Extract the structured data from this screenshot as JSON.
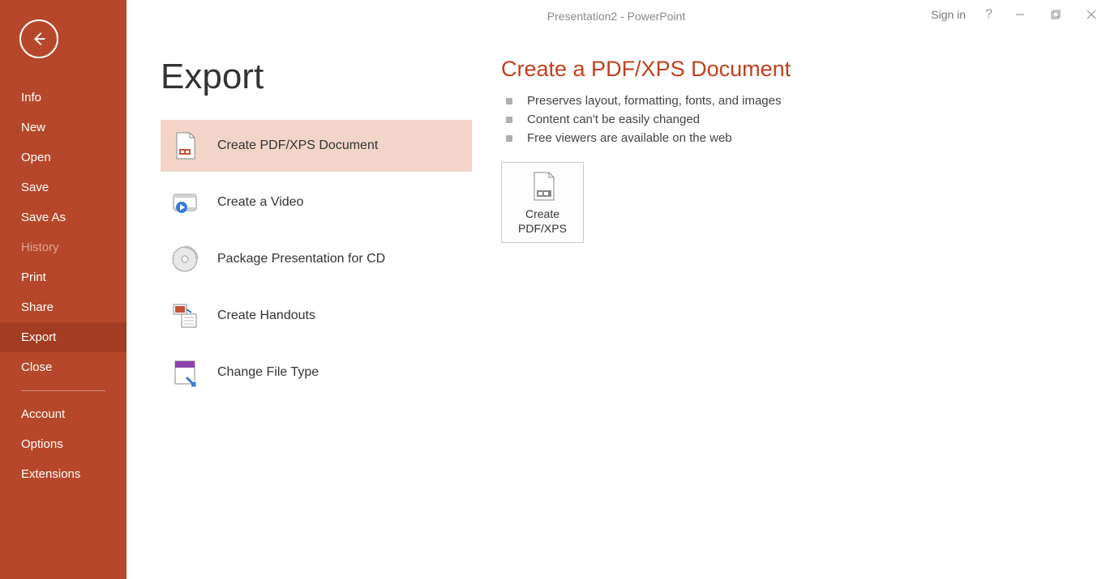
{
  "window": {
    "title": "Presentation2  -  PowerPoint",
    "signin": "Sign in",
    "help": "?"
  },
  "sidebar": {
    "items": [
      {
        "label": "Info",
        "key": "info"
      },
      {
        "label": "New",
        "key": "new"
      },
      {
        "label": "Open",
        "key": "open"
      },
      {
        "label": "Save",
        "key": "save"
      },
      {
        "label": "Save As",
        "key": "save-as"
      },
      {
        "label": "History",
        "key": "history",
        "disabled": true
      },
      {
        "label": "Print",
        "key": "print"
      },
      {
        "label": "Share",
        "key": "share"
      },
      {
        "label": "Export",
        "key": "export",
        "selected": true
      },
      {
        "label": "Close",
        "key": "close"
      }
    ],
    "footer": [
      {
        "label": "Account",
        "key": "account"
      },
      {
        "label": "Options",
        "key": "options"
      },
      {
        "label": "Extensions",
        "key": "extensions"
      }
    ]
  },
  "page": {
    "title": "Export",
    "export_options": [
      {
        "label": "Create PDF/XPS Document",
        "key": "pdfxps",
        "selected": true
      },
      {
        "label": "Create a Video",
        "key": "video"
      },
      {
        "label": "Package Presentation for CD",
        "key": "cd"
      },
      {
        "label": "Create Handouts",
        "key": "handouts"
      },
      {
        "label": "Change File Type",
        "key": "filetype"
      }
    ],
    "detail": {
      "title": "Create a PDF/XPS Document",
      "bullets": [
        "Preserves layout, formatting, fonts, and images",
        "Content can't be easily changed",
        "Free viewers are available on the web"
      ],
      "action_label_1": "Create",
      "action_label_2": "PDF/XPS"
    }
  }
}
